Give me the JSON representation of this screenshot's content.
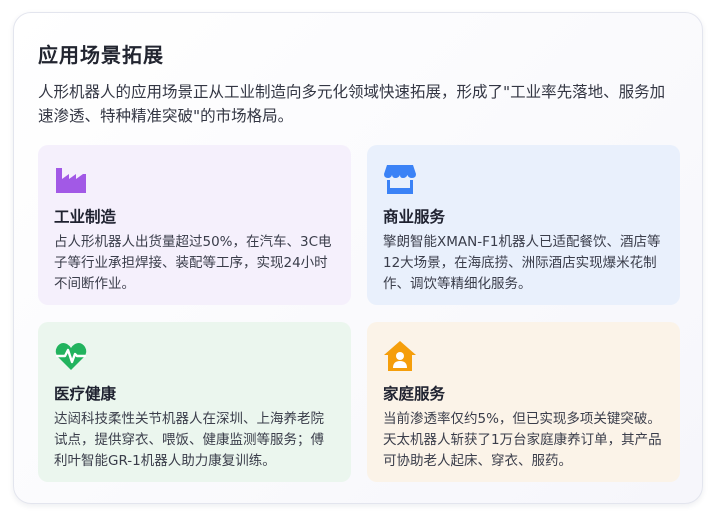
{
  "card": {
    "title": "应用场景拓展",
    "intro": "人形机器人的应用场景正从工业制造向多元化领域快速拓展，形成了\"工业率先落地、服务加速渗透、特种精准突破\"的市场格局。"
  },
  "tiles": [
    {
      "icon": "factory-icon",
      "icon_color": "#a259e6",
      "title": "工业制造",
      "desc": "占人形机器人出货量超过50%，在汽车、3C电子等行业承担焊接、装配等工序，实现24小时不间断作业。"
    },
    {
      "icon": "store-icon",
      "icon_color": "#3b82f6",
      "title": "商业服务",
      "desc": "擎朗智能XMAN-F1机器人已适配餐饮、酒店等12大场景，在海底捞、洲际酒店实现爆米花制作、调饮等精细化服务。"
    },
    {
      "icon": "heartbeat-icon",
      "icon_color": "#22b35e",
      "title": "医疗健康",
      "desc": "达闼科技柔性关节机器人在深圳、上海养老院试点，提供穿衣、喂饭、健康监测等服务；傅利叶智能GR-1机器人助力康复训练。"
    },
    {
      "icon": "house-user-icon",
      "icon_color": "#f59e0b",
      "title": "家庭服务",
      "desc": "当前渗透率仅约5%，但已实现多项关键突破。天太机器人斩获了1万台家庭康养订单，其产品可协助老人起床、穿衣、服药。"
    }
  ]
}
